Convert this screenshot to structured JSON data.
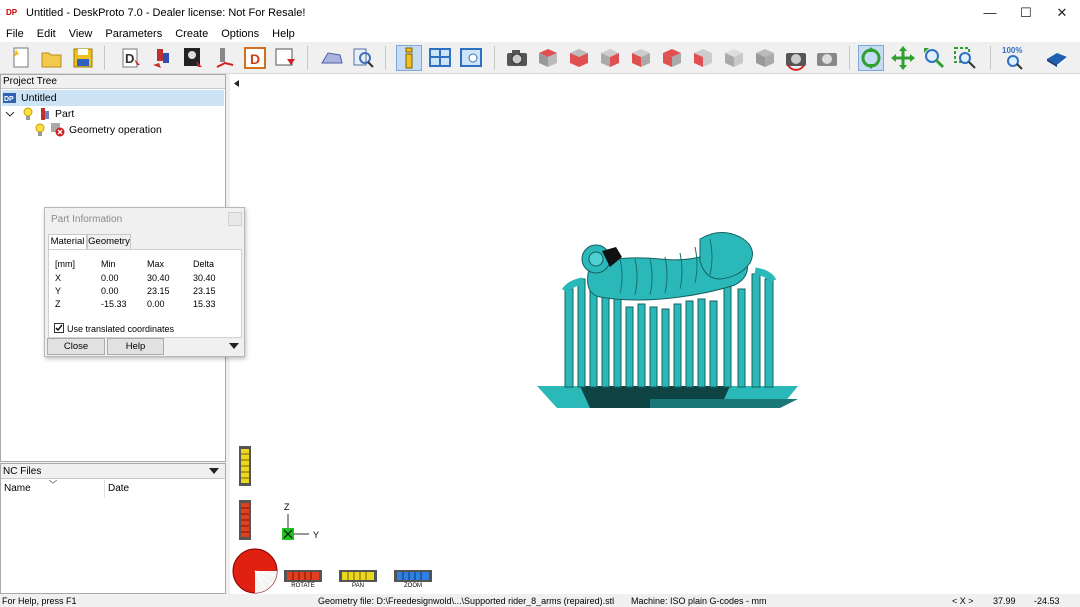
{
  "window": {
    "title": "Untitled - DeskProto 7.0 - Dealer license: Not For Resale!",
    "logo_text": "DP",
    "minimize": "—",
    "maximize": "☐",
    "close": "✕"
  },
  "menu": [
    "File",
    "Edit",
    "View",
    "Parameters",
    "Create",
    "Options",
    "Help"
  ],
  "toolbar": {
    "zoom_percent": "100%"
  },
  "project_tree": {
    "header": "Project Tree",
    "root": "Untitled",
    "part": "Part",
    "operation": "Geometry operation"
  },
  "nc_files": {
    "header": "NC Files",
    "col_name": "Name",
    "col_date": "Date"
  },
  "part_info": {
    "title": "Part Information",
    "tabs": [
      "Material",
      "Geometry"
    ],
    "headers": [
      "[mm]",
      "Min",
      "Max",
      "Delta"
    ],
    "rows": [
      {
        "axis": "X",
        "min": "0.00",
        "max": "30.40",
        "delta": "30.40"
      },
      {
        "axis": "Y",
        "min": "0.00",
        "max": "23.15",
        "delta": "23.15"
      },
      {
        "axis": "Z",
        "min": "-15.33",
        "max": "0.00",
        "delta": "15.33"
      }
    ],
    "checkbox_label": "Use translated coordinates",
    "checkbox_checked": true,
    "close_label": "Close",
    "help_label": "Help"
  },
  "viewport": {
    "axis_z": "Z",
    "axis_y": "Y",
    "dial_labels": [
      "ROTATE",
      "PAN",
      "ZOOM"
    ]
  },
  "status": {
    "help": "For Help, press F1",
    "geometry_file": "Geometry file: D:\\Freedesignwold\\...\\Supported rider_8_arms (repaired).stl",
    "machine": "Machine: ISO plain G-codes - mm",
    "coord_label": "< X >",
    "x": "37.99",
    "y": "-24.53"
  },
  "colors": {
    "model": "#2bb8b8",
    "model_dark": "#1a7777",
    "selection": "#cde4f7"
  }
}
